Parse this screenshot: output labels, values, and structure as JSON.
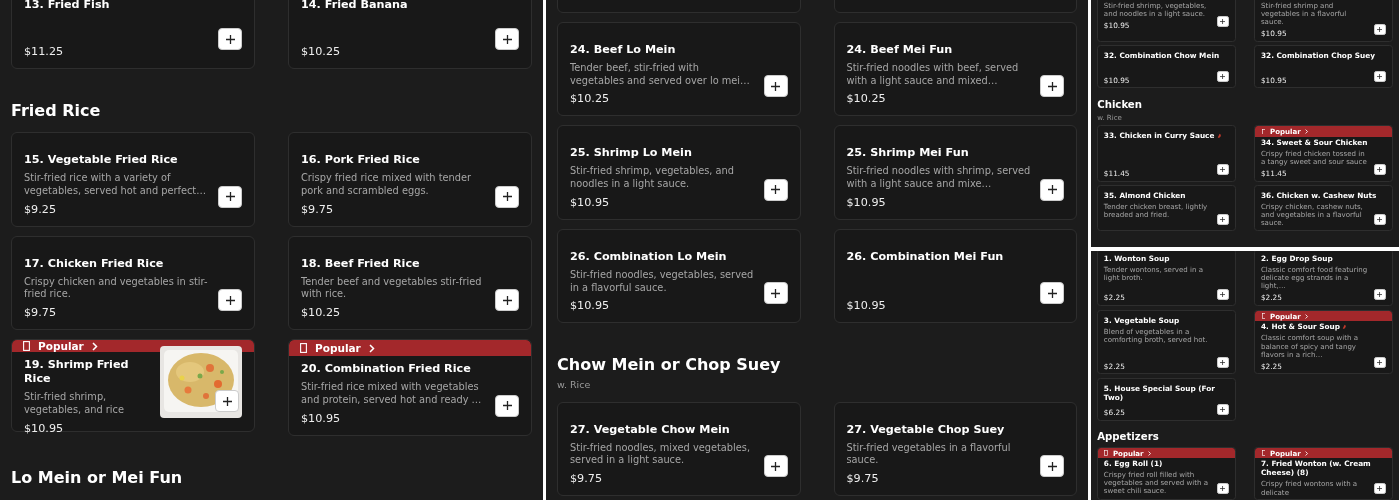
{
  "panels": [
    {
      "blocks": [
        {
          "kind": "cards",
          "items": [
            {
              "name": "13. Fried Fish",
              "price": "$11.25",
              "spicy": false
            },
            {
              "name": "14. Fried Banana",
              "price": "$10.25",
              "spicy": false
            }
          ]
        },
        {
          "kind": "heading",
          "title": "Fried Rice"
        },
        {
          "kind": "cards",
          "items": [
            {
              "name": "15. Vegetable Fried Rice",
              "description": "Stir-fried rice with a variety of vegetables, served hot and perfect…",
              "price": "$9.25",
              "spicy": false
            },
            {
              "name": "16. Pork Fried Rice",
              "description": "Crispy fried rice mixed with tender pork and scrambled eggs.",
              "price": "$9.75",
              "spicy": false
            },
            {
              "name": "17. Chicken Fried Rice",
              "description": "Crispy chicken and vegetables in stir-fried rice.",
              "price": "$9.75",
              "spicy": false
            },
            {
              "name": "18. Beef Fried Rice",
              "description": "Tender beef and vegetables stir-fried with rice.",
              "price": "$10.25",
              "spicy": false
            },
            {
              "badge": "Popular",
              "name": "19. Shrimp Fried Rice",
              "description": "Stir-fried shrimp, vegetables, and rice",
              "price": "$10.95",
              "spicy": false
            },
            {
              "badge": "Popular",
              "name": "20. Combination Fried Rice",
              "description": "Stir-fried rice mixed with vegetables and protein, served hot and ready …",
              "price": "$10.95",
              "spicy": false
            }
          ]
        },
        {
          "kind": "heading",
          "title": "Lo Mein or Mei Fun"
        }
      ]
    },
    {
      "blocks": [
        {
          "kind": "cards",
          "items": [
            {
              "spicy": false
            },
            {
              "spicy": false
            },
            {
              "name": "24. Beef Lo Mein",
              "description": "Tender beef, stir-fried with vegetables and served over lo mei…",
              "price": "$10.25",
              "spicy": false
            },
            {
              "name": "24. Beef Mei Fun",
              "description": "Stir-fried noodles with beef, served with a light sauce and mixed…",
              "price": "$10.25",
              "spicy": false
            },
            {
              "name": "25. Shrimp Lo Mein",
              "description": "Stir-fried shrimp, vegetables, and noodles in a light sauce.",
              "price": "$10.95",
              "spicy": false
            },
            {
              "name": "25. Shrimp Mei Fun",
              "description": "Stir-fried noodles with shrimp, served with a light sauce and mixe…",
              "price": "$10.95",
              "spicy": false
            },
            {
              "name": "26. Combination Lo Mein",
              "description": "Stir-fried noodles, vegetables, served in a flavorful sauce.",
              "price": "$10.95",
              "spicy": false
            },
            {
              "name": "26. Combination Mei Fun",
              "price": "$10.95",
              "spicy": false
            }
          ]
        },
        {
          "kind": "heading",
          "title": "Chow Mein or Chop Suey",
          "subtitle": "w. Rice"
        },
        {
          "kind": "cards",
          "items": [
            {
              "name": "27. Vegetable Chow Mein",
              "description": "Stir-fried noodles, mixed vegetables, served in a light sauce.",
              "price": "$9.75",
              "spicy": false
            },
            {
              "name": "27. Vegetable Chop Suey",
              "description": "Stir-fried vegetables in a flavorful sauce.",
              "price": "$9.75",
              "spicy": false
            }
          ]
        }
      ]
    },
    {
      "blocks": [
        {
          "kind": "cards",
          "items": [
            {
              "description": "Stir-fried shrimp, vegetables, and noodles in a light sauce.",
              "price": "$10.95",
              "spicy": false
            },
            {
              "description": "Stir-fried shrimp and vegetables in a flavorful sauce.",
              "price": "$10.95",
              "spicy": false
            },
            {
              "name": "32. Combination Chow Mein",
              "price": "$10.95",
              "spicy": false
            },
            {
              "name": "32. Combination Chop Suey",
              "price": "$10.95",
              "spicy": false
            }
          ]
        },
        {
          "kind": "heading",
          "title": "Chicken",
          "subtitle": "w. Rice"
        },
        {
          "kind": "cards",
          "items": [
            {
              "name": "33. Chicken in Curry Sauce",
              "price": "$11.45",
              "spicy": true
            },
            {
              "badge": "Popular",
              "name": "34. Sweet & Sour Chicken",
              "description": "Crispy fried chicken tossed in a tangy sweet and sour sauce",
              "price": "$11.45",
              "spicy": false
            },
            {
              "name": "35. Almond Chicken",
              "description": "Tender chicken breast, lightly breaded and fried.",
              "spicy": false
            },
            {
              "name": "36. Chicken w. Cashew Nuts",
              "description": "Crispy chicken, cashew nuts, and vegetables in a flavorful sauce.",
              "spicy": false
            }
          ]
        }
      ]
    },
    {
      "blocks": [
        {
          "kind": "cards",
          "items": [
            {
              "name": "1. Wonton Soup",
              "description": "Tender wontons, served in a light broth.",
              "price": "$2.25",
              "spicy": false
            },
            {
              "name": "2. Egg Drop Soup",
              "description": "Classic comfort food featuring delicate egg strands in a light,…",
              "price": "$2.25",
              "spicy": false
            },
            {
              "name": "3. Vegetable Soup",
              "description": "Blend of vegetables in a comforting broth, served hot.",
              "price": "$2.25",
              "spicy": false
            },
            {
              "badge": "Popular",
              "name": "4. Hot & Sour Soup",
              "description": "Classic comfort soup with a balance of spicy and tangy flavors in a rich…",
              "price": "$2.25",
              "spicy": true
            },
            {
              "name": "5. House Special Soup (For Two)",
              "price": "$6.25",
              "spicy": false
            }
          ]
        },
        {
          "kind": "heading",
          "title": "Appetizers"
        },
        {
          "kind": "cards",
          "items": [
            {
              "badge": "Popular",
              "name": "6. Egg Roll (1)",
              "description": "Crispy fried roll filled with vegetables and served with a sweet chili sauce.",
              "spicy": false
            },
            {
              "badge": "Popular",
              "name": "7. Fried Wonton (w. Cream Cheese) (8)",
              "description": "Crispy fried wontons with a delicate",
              "spicy": false
            }
          ]
        }
      ]
    }
  ]
}
